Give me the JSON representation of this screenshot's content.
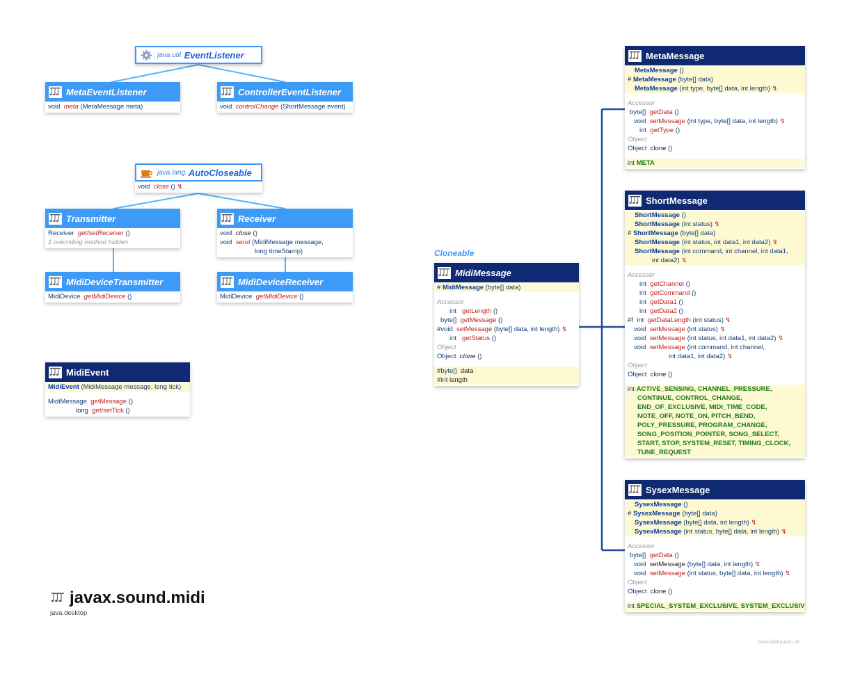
{
  "package": {
    "name": "javax.sound.midi",
    "module": "java.desktop",
    "credit": "www.falkhausen.de"
  },
  "event_listener": {
    "pkg": "java.util.",
    "name": "EventListener"
  },
  "meta_event_listener": {
    "name": "MetaEventListener",
    "rows": [
      "void",
      "meta",
      "(MetaMessage meta)"
    ]
  },
  "controller_event_listener": {
    "name": "ControllerEventListener",
    "rows": [
      "void",
      "controlChange",
      "(ShortMessage event)"
    ]
  },
  "auto_closeable": {
    "pkg": "java.lang.",
    "name": "AutoCloseable",
    "rows": [
      "void",
      "close",
      "()",
      "↯"
    ]
  },
  "transmitter": {
    "name": "Transmitter",
    "row1": [
      "Receiver",
      "get/setReceiver",
      "()"
    ],
    "row2": "1 overriding method hidden"
  },
  "receiver": {
    "name": "Receiver",
    "row1": [
      "void",
      "close",
      "()"
    ],
    "row2": [
      "void",
      "send",
      "(MidiMessage message,"
    ],
    "row3": "long timeStamp)"
  },
  "midi_device_transmitter": {
    "name": "MidiDeviceTransmitter",
    "rows": [
      "MidiDevice",
      "getMidiDevice",
      "()"
    ]
  },
  "midi_device_receiver": {
    "name": "MidiDeviceReceiver",
    "rows": [
      "MidiDevice",
      "getMidiDevice",
      "()"
    ]
  },
  "midi_event": {
    "name": "MidiEvent",
    "ctor": [
      "MidiEvent",
      "(MidiMessage message, long tick)"
    ],
    "m1": [
      "MidiMessage",
      "getMessage",
      "()"
    ],
    "m2": [
      "long",
      "get/setTick",
      "()"
    ]
  },
  "midi_message": {
    "stereotype": "Cloneable",
    "name": "MidiMessage",
    "ctor": [
      "#",
      "MidiMessage",
      "(byte[] data)"
    ],
    "accessor": "Accessor",
    "m1": [
      "int",
      "getLength",
      "()"
    ],
    "m2": [
      "byte[]",
      "getMessage",
      "()"
    ],
    "m3": [
      "#",
      "void",
      "setMessage",
      "(byte[] data, int length)",
      "↯"
    ],
    "m4": [
      "int",
      "getStatus",
      "()"
    ],
    "object": "Object",
    "m5": [
      "Object",
      "clone",
      "()"
    ],
    "f1": [
      "#",
      "byte[]",
      "data"
    ],
    "f2": [
      "#",
      "int",
      "length"
    ]
  },
  "meta_message": {
    "name": "MetaMessage",
    "c1": [
      "MetaMessage",
      "()"
    ],
    "c2": [
      "#",
      "MetaMessage",
      "(byte[] data)"
    ],
    "c3": [
      "MetaMessage",
      "(int type, byte[] data, int length)",
      "↯"
    ],
    "accessor": "Accessor",
    "m1": [
      "byte[]",
      "getData",
      "()"
    ],
    "m2": [
      "void",
      "setMessage",
      "(int type, byte[] data, int length)",
      "↯"
    ],
    "m3": [
      "int",
      "getType",
      "()"
    ],
    "object": "Object",
    "m4": [
      "Object",
      "clone",
      "()"
    ],
    "f1": [
      "int",
      "META"
    ]
  },
  "short_message": {
    "name": "ShortMessage",
    "c1": [
      "ShortMessage",
      "()"
    ],
    "c2": [
      "ShortMessage",
      "(int status)",
      "↯"
    ],
    "c3": [
      "#",
      "ShortMessage",
      "(byte[] data)"
    ],
    "c4": [
      "ShortMessage",
      "(int status, int data1, int data2)",
      "↯"
    ],
    "c5": [
      "ShortMessage",
      "(int command, int channel, int data1,",
      "int data2)",
      "↯"
    ],
    "accessor": "Accessor",
    "m1": [
      "int",
      "getChannel",
      "()"
    ],
    "m2": [
      "int",
      "getCommand",
      "()"
    ],
    "m3": [
      "int",
      "getData1",
      "()"
    ],
    "m4": [
      "int",
      "getData2",
      "()"
    ],
    "m5": [
      "#f",
      "int",
      "getDataLength",
      "(int status)",
      "↯"
    ],
    "m6": [
      "void",
      "setMessage",
      "(int status)",
      "↯"
    ],
    "m7": [
      "void",
      "setMessage",
      "(int status, int data1, int data2)",
      "↯"
    ],
    "m8": [
      "void",
      "setMessage",
      "(int command, int channel,",
      "int data1, int data2)",
      "↯"
    ],
    "object": "Object",
    "m9": [
      "Object",
      "clone",
      "()"
    ],
    "ftype": "int",
    "fields": [
      "ACTIVE_SENSING, CHANNEL_PRESSURE,",
      "CONTINUE, CONTROL_CHANGE,",
      "END_OF_EXCLUSIVE, MIDI_TIME_CODE,",
      "NOTE_OFF, NOTE_ON, PITCH_BEND,",
      "POLY_PRESSURE, PROGRAM_CHANGE,",
      "SONG_POSITION_POINTER, SONG_SELECT,",
      "START, STOP, SYSTEM_RESET, TIMING_CLOCK,",
      "TUNE_REQUEST"
    ]
  },
  "sysex_message": {
    "name": "SysexMessage",
    "c1": [
      "SysexMessage",
      "()"
    ],
    "c2": [
      "#",
      "SysexMessage",
      "(byte[] data)"
    ],
    "c3": [
      "SysexMessage",
      "(byte[] data, int length)",
      "↯"
    ],
    "c4": [
      "SysexMessage",
      "(int status, byte[] data, int length)",
      "↯"
    ],
    "accessor": "Accessor",
    "m1": [
      "byte[]",
      "getData",
      "()"
    ],
    "m2": [
      "void",
      "setMessage",
      "(byte[] data, int length)",
      "↯"
    ],
    "m3": [
      "void",
      "setMessage",
      "(int status, byte[] data, int length)",
      "↯"
    ],
    "object": "Object",
    "m4": [
      "Object",
      "clone",
      "()"
    ],
    "f1": [
      "int",
      "SPECIAL_SYSTEM_EXCLUSIVE, SYSTEM_EXCLUSIVE"
    ]
  },
  "colors": {
    "interface": "#3d9bf7",
    "class": "#0f2a73",
    "link_light": "#54b4f5",
    "link_dark": "#1f4e9a",
    "highlight": "#fdf9d2"
  }
}
